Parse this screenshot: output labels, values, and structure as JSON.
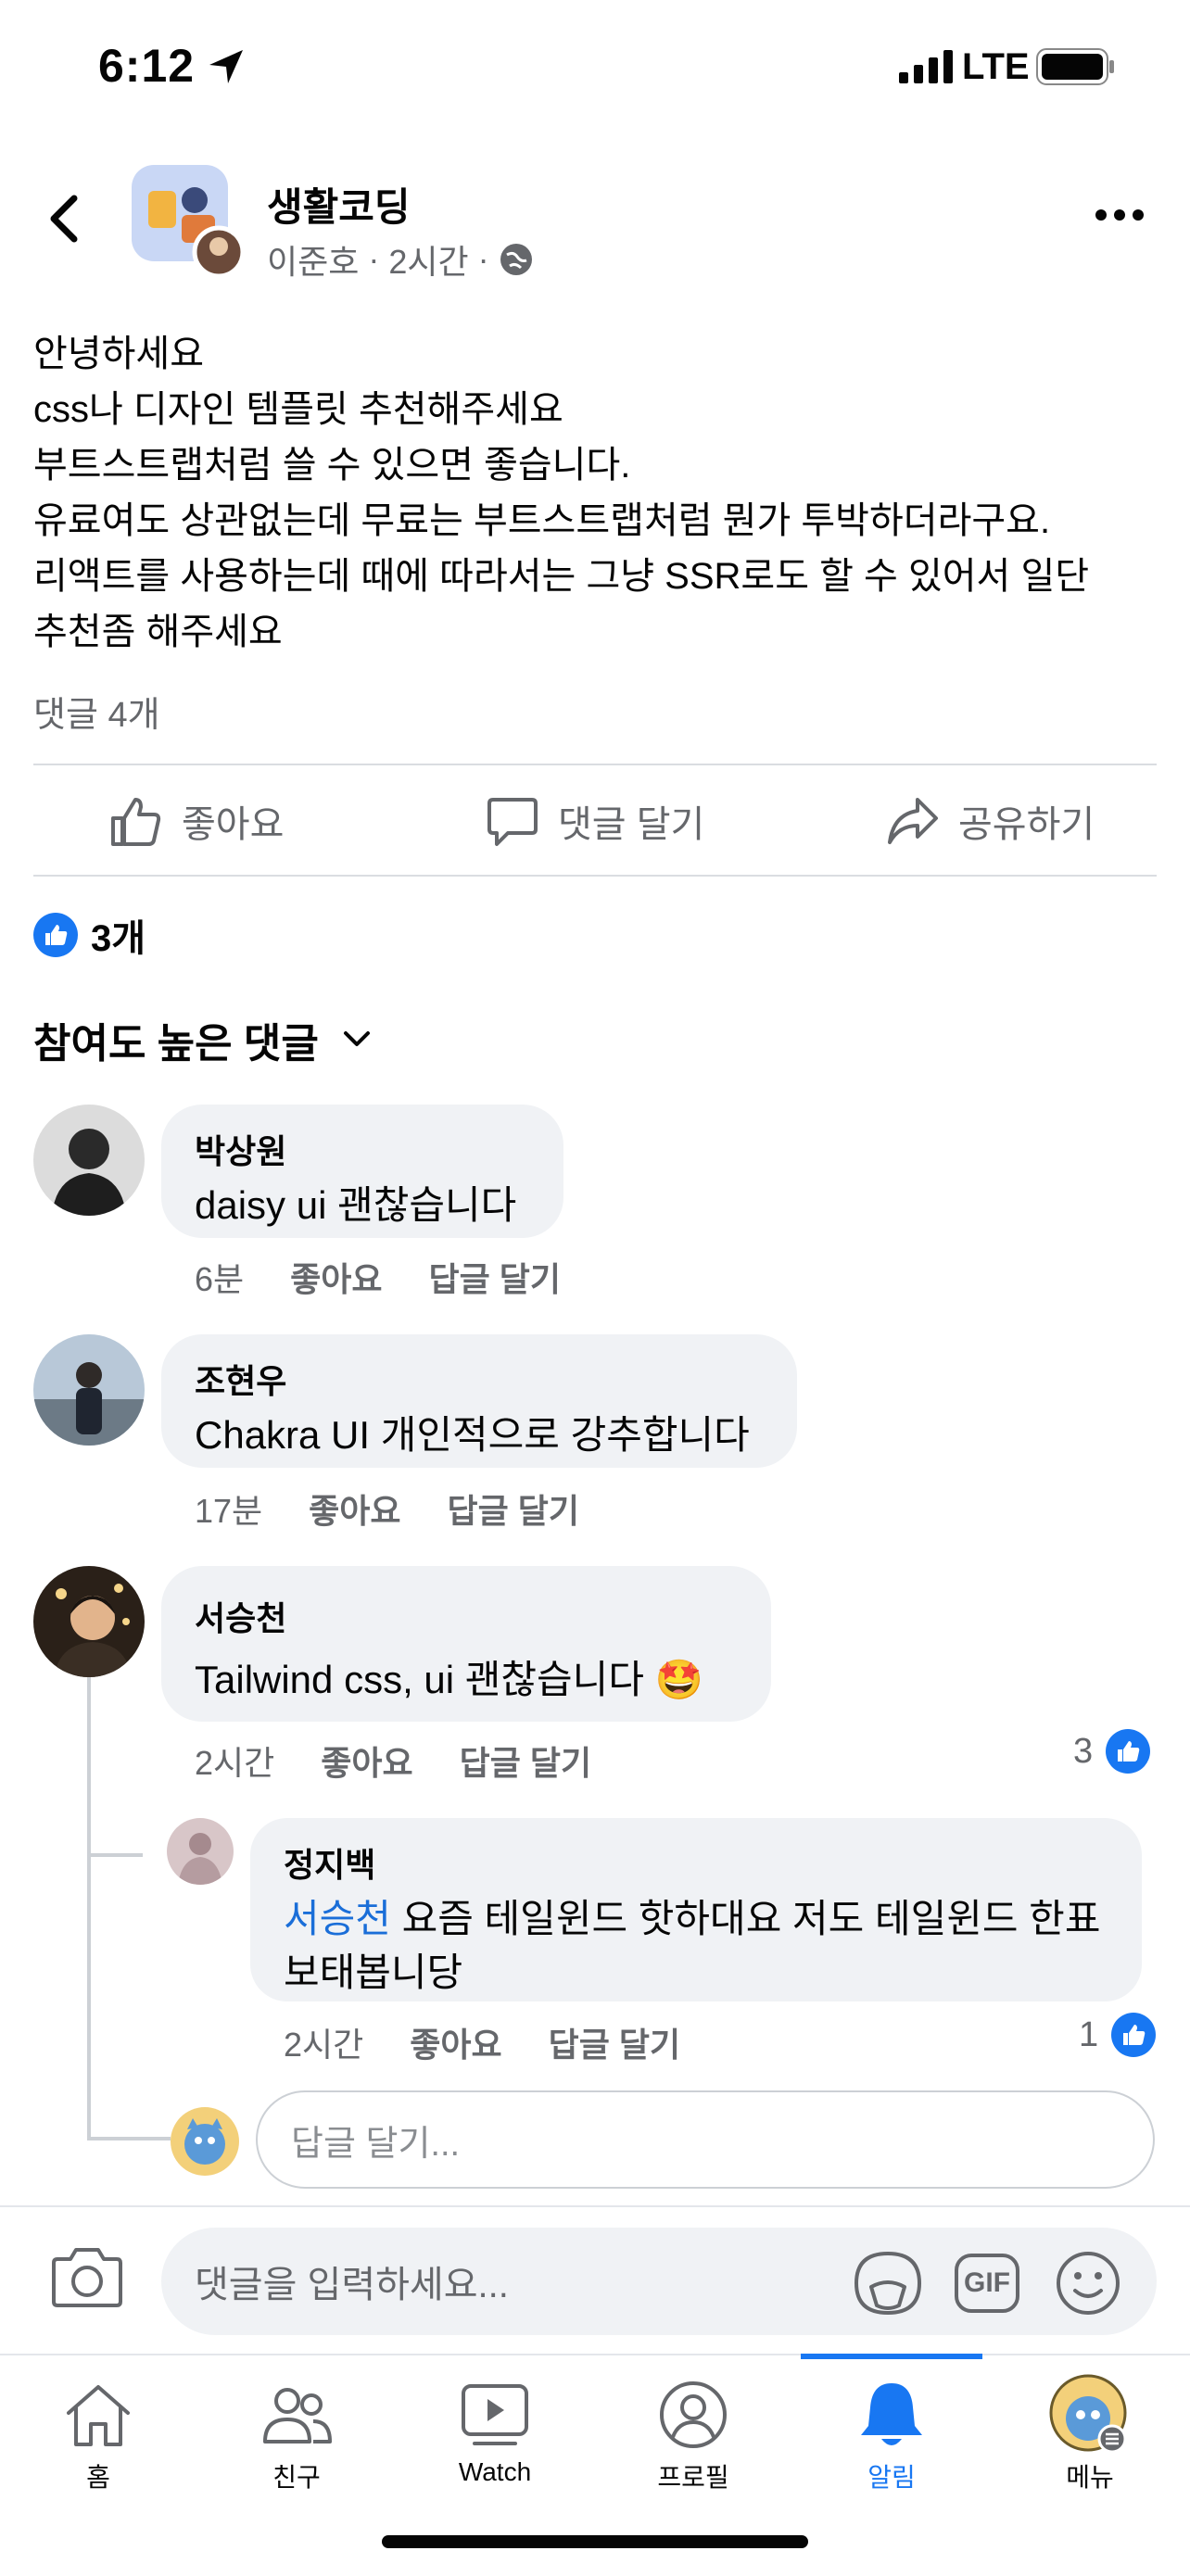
{
  "status": {
    "time": "6:12",
    "network": "LTE"
  },
  "post": {
    "group_name": "생활코딩",
    "author": "이준호",
    "time": "2시간",
    "separator": "·",
    "text": "안녕하세요\ncss나 디자인 템플릿 추천해주세요\n부트스트랩처럼 쓸 수 있으면 좋습니다.\n유료여도 상관없는데 무료는 부트스트랩처럼 뭔가 투박하더라구요.\n리액트를 사용하는데 때에 따라서는 그냥 SSR로도 할 수 있어서 일단\n추천좀 해주세요",
    "comment_count": "댓글 4개",
    "reaction_count": "3개"
  },
  "actions": {
    "like": "좋아요",
    "comment": "댓글 달기",
    "share": "공유하기"
  },
  "sort_label": "참여도 높은 댓글",
  "comments": [
    {
      "name": "박상원",
      "text": "daisy ui 괜찮습니다",
      "time": "6분",
      "like": "좋아요",
      "reply": "답글 달기"
    },
    {
      "name": "조현우",
      "text": "Chakra UI 개인적으로 강추합니다",
      "time": "17분",
      "like": "좋아요",
      "reply": "답글 달기"
    },
    {
      "name": "서승천",
      "text": "Tailwind css, ui 괜찮습니다 🤩",
      "time": "2시간",
      "like": "좋아요",
      "reply": "답글 달기",
      "reactions": "3"
    }
  ],
  "reply": {
    "name": "정지백",
    "mention": "서승천",
    "text": " 요즘 테일윈드 핫하대요 저도 테일윈드 한표 보태봅니당",
    "time": "2시간",
    "like": "좋아요",
    "reply": "답글 달기",
    "reactions": "1"
  },
  "reply_placeholder": "답글 달기...",
  "composer_placeholder": "댓글을 입력하세요...",
  "composer_gif": "GIF",
  "tabs": [
    {
      "label": "홈",
      "icon": "home-icon"
    },
    {
      "label": "친구",
      "icon": "friends-icon"
    },
    {
      "label": "Watch",
      "icon": "watch-icon"
    },
    {
      "label": "프로필",
      "icon": "profile-icon"
    },
    {
      "label": "알림",
      "icon": "bell-icon",
      "active": true
    },
    {
      "label": "메뉴",
      "icon": "menu-avatar"
    }
  ],
  "colors": {
    "accent": "#1877f2",
    "bubble": "#f0f2f5",
    "meta": "#65676b"
  }
}
